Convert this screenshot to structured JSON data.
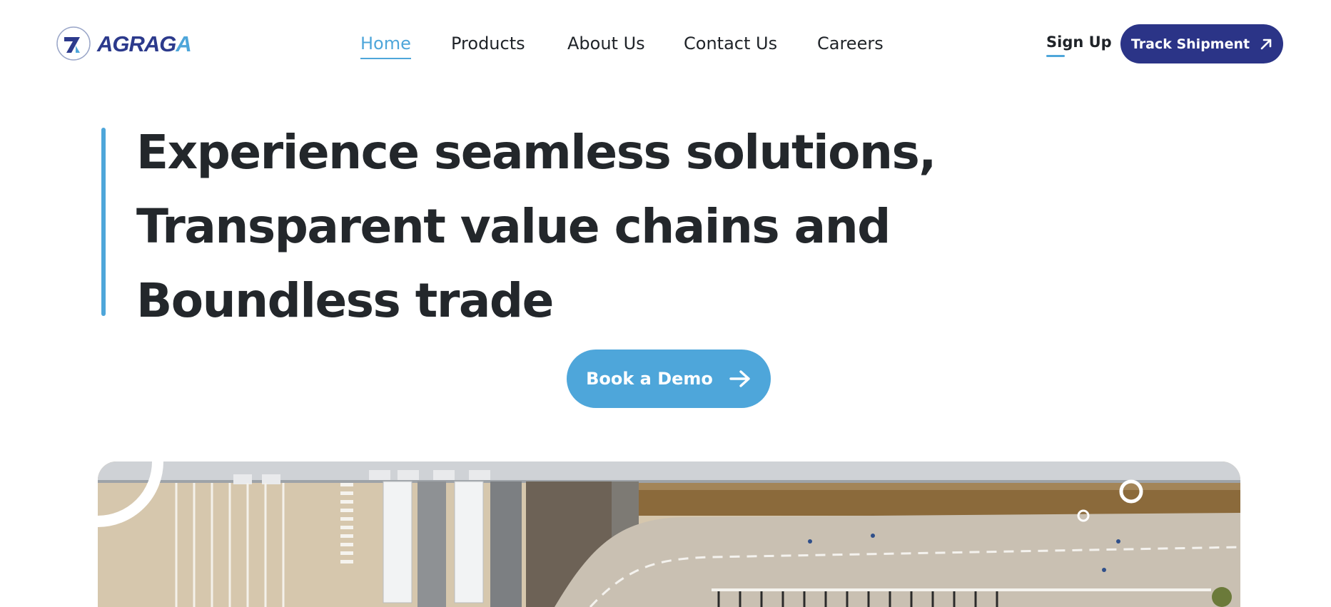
{
  "brand": {
    "name_main": "AGRAG",
    "name_tail": "A"
  },
  "nav": {
    "items": [
      {
        "label": "Home",
        "active": true
      },
      {
        "label": "Products",
        "active": false
      },
      {
        "label": "About Us",
        "active": false
      },
      {
        "label": "Contact Us",
        "active": false
      },
      {
        "label": "Careers",
        "active": false
      }
    ]
  },
  "header": {
    "signup_label": "Sign Up",
    "track_label": "Track Shipment",
    "track_icon": "arrow-up-right-icon"
  },
  "hero": {
    "lines": [
      "Experience seamless solutions,",
      "Transparent value chains and",
      "Boundless trade"
    ],
    "cta_label": "Book a Demo",
    "cta_icon": "arrow-right-icon"
  },
  "colors": {
    "brand_navy": "#2b3487",
    "brand_blue": "#4ea6da",
    "text": "#23272b"
  }
}
